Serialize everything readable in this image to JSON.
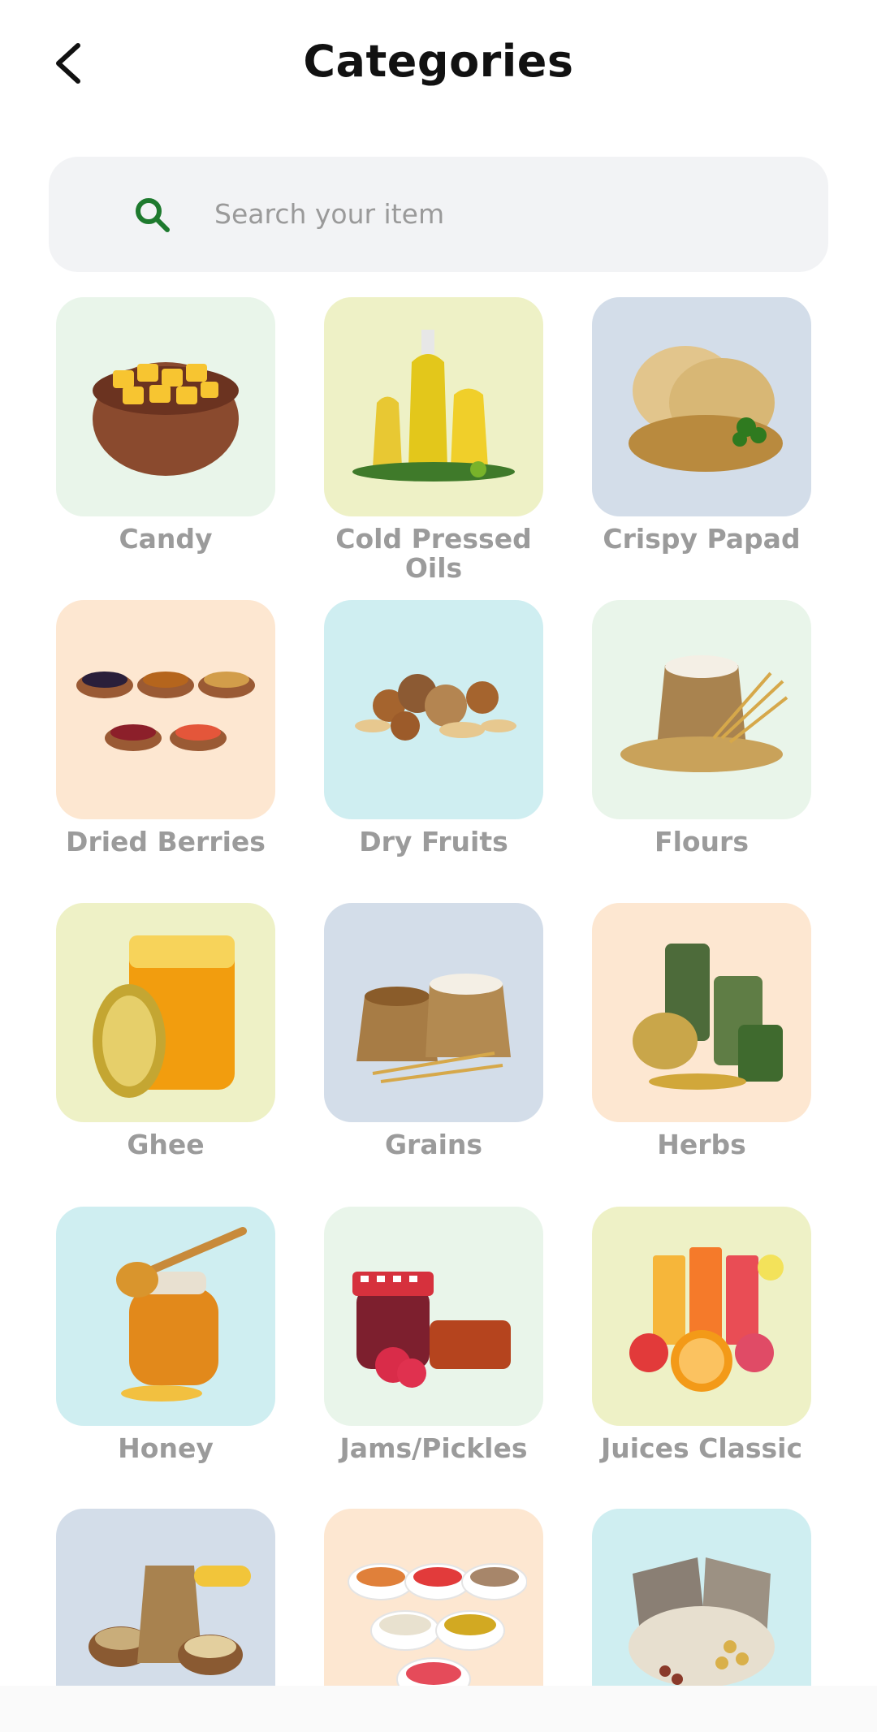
{
  "header": {
    "title": "Categories",
    "back_icon": "chevron-left-icon"
  },
  "search": {
    "placeholder": "Search your item",
    "value": "",
    "icon": "search-icon",
    "icon_color": "#1e7a2e"
  },
  "label_color": "#9b9b9b",
  "categories": [
    {
      "label": "Candy",
      "bg": "#e9f5ea",
      "icon": "candy-bowl-icon"
    },
    {
      "label": "Cold Pressed Oils",
      "bg": "#eef1c6",
      "icon": "oil-bottles-icon"
    },
    {
      "label": "Crispy Papad",
      "bg": "#d3dde9",
      "icon": "papad-basket-icon"
    },
    {
      "label": "Dried Berries",
      "bg": "#fde7d1",
      "icon": "dried-berries-icon"
    },
    {
      "label": "Dry Fruits",
      "bg": "#cfeef1",
      "icon": "dry-fruits-icon"
    },
    {
      "label": "Flours",
      "bg": "#e9f5ea",
      "icon": "flour-sack-icon"
    },
    {
      "label": "Ghee",
      "bg": "#eef1c6",
      "icon": "ghee-jar-icon"
    },
    {
      "label": "Grains",
      "bg": "#d3dde9",
      "icon": "grain-sacks-icon"
    },
    {
      "label": "Herbs",
      "bg": "#fde7d1",
      "icon": "herb-jars-icon"
    },
    {
      "label": "Honey",
      "bg": "#cfeef1",
      "icon": "honey-jar-icon"
    },
    {
      "label": "Jams/Pickles",
      "bg": "#e9f5ea",
      "icon": "jam-jar-icon"
    },
    {
      "label": "Juices Classic",
      "bg": "#eef1c6",
      "icon": "juice-glasses-icon"
    },
    {
      "label": "",
      "bg": "#d3dde9",
      "icon": "millets-icon"
    },
    {
      "label": "",
      "bg": "#fde7d1",
      "icon": "mukhwas-bowls-icon"
    },
    {
      "label": "",
      "bg": "#cfeef1",
      "icon": "pulses-sacks-icon"
    }
  ]
}
